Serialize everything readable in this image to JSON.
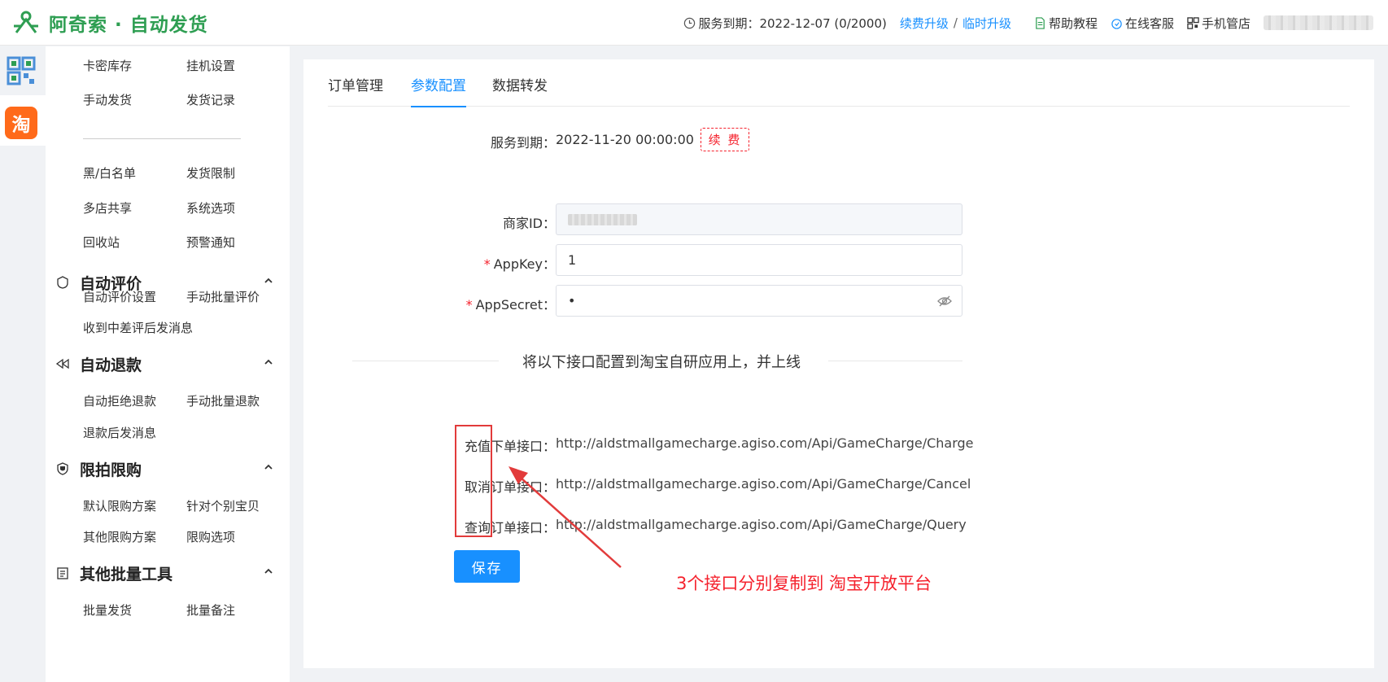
{
  "header": {
    "brand": "阿奇索 · 自动发货",
    "service_text": "服务到期：2022-12-07 (0/2000)",
    "renew_upgrade": "续费升级",
    "slash": "/",
    "temp_upgrade": "临时升级",
    "help": "帮助教程",
    "online_service": "在线客服",
    "mobile_shop": "手机管店"
  },
  "sidebar": {
    "rows": [
      [
        "卡密库存",
        "挂机设置"
      ],
      [
        "手动发货",
        "发货记录"
      ],
      [
        "黑/白名单",
        "发货限制"
      ],
      [
        "多店共享",
        "系统选项"
      ],
      [
        "回收站",
        "预警通知"
      ]
    ],
    "groups": [
      {
        "title": "自动评价",
        "items": [
          [
            "自动评价设置",
            "手动批量评价"
          ],
          [
            "收到中差评后发消息",
            ""
          ]
        ]
      },
      {
        "title": "自动退款",
        "items": [
          [
            "自动拒绝退款",
            "手动批量退款"
          ],
          [
            "退款后发消息",
            ""
          ]
        ]
      },
      {
        "title": "限拍限购",
        "items": [
          [
            "默认限购方案",
            "针对个别宝贝"
          ],
          [
            "其他限购方案",
            "限购选项"
          ]
        ]
      },
      {
        "title": "其他批量工具",
        "items": [
          [
            "批量发货",
            "批量备注"
          ]
        ]
      }
    ],
    "tao_label": "淘"
  },
  "tabs": [
    "订单管理",
    "参数配置",
    "数据转发"
  ],
  "form": {
    "service_label": "服务到期：",
    "service_value": "2022-11-20 00:00:00",
    "renew_btn": "续 费",
    "merchant_label": "商家ID：",
    "appkey_label": "AppKey：",
    "appkey_value": "1",
    "appsecret_label": "AppSecret：",
    "appsecret_value": "•",
    "req_mark": "*",
    "divider_text": "将以下接口配置到淘宝自研应用上，并上线",
    "save": "保存"
  },
  "apis": [
    {
      "label": "充值下单接口：",
      "url": "http://aldstmallgamecharge.agiso.com/Api/GameCharge/Charge"
    },
    {
      "label": "取消订单接口：",
      "url": "http://aldstmallgamecharge.agiso.com/Api/GameCharge/Cancel"
    },
    {
      "label": "查询订单接口：",
      "url": "http://aldstmallgamecharge.agiso.com/Api/GameCharge/Query"
    }
  ],
  "annotation": "3个接口分别复制到 淘宝开放平台",
  "colors": {
    "brand_green": "#2e9e52",
    "link_blue": "#1890ff",
    "annot_red": "#f5222d"
  }
}
